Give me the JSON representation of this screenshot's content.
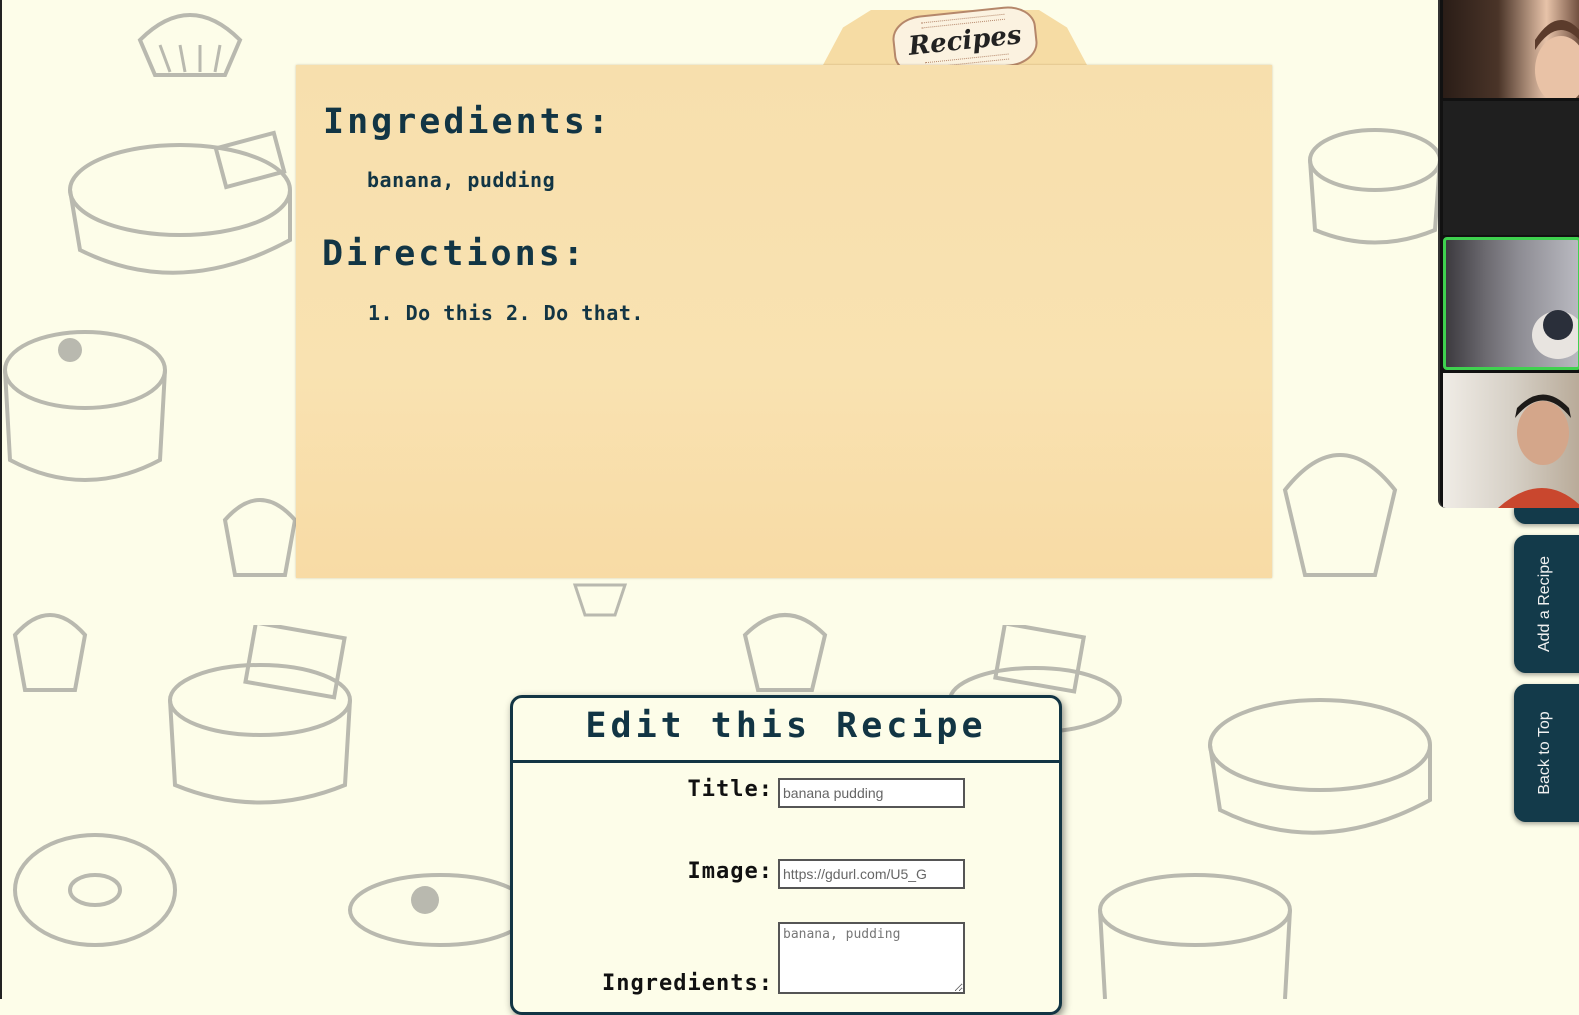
{
  "recipe": {
    "tab_label": "Recipes",
    "ingredients_heading": "Ingredients:",
    "ingredients_text": "banana, pudding",
    "directions_heading": "Directions:",
    "directions_text": "1. Do this 2. Do that."
  },
  "edit_form": {
    "heading": "Edit this Recipe",
    "title_label": "Title:",
    "title_placeholder": "banana pudding",
    "image_label": "Image:",
    "image_placeholder": "https://gdurl.com/U5_G",
    "ingredients_label": "Ingredients:",
    "ingredients_placeholder": "banana, pudding"
  },
  "side_nav": {
    "add_recipe": "Add a Recipe",
    "back_to_top": "Back to Top"
  },
  "video_call": {
    "participants": [
      "participant-1",
      "participant-2",
      "participant-3",
      "participant-4"
    ],
    "active_speaker_index": 2,
    "active_color": "#3fd14f"
  },
  "colors": {
    "background": "#fdfde9",
    "card": "#f7dfad",
    "ink": "#123544",
    "side_tab": "#133a4a",
    "sketch": "#b9b9af"
  }
}
